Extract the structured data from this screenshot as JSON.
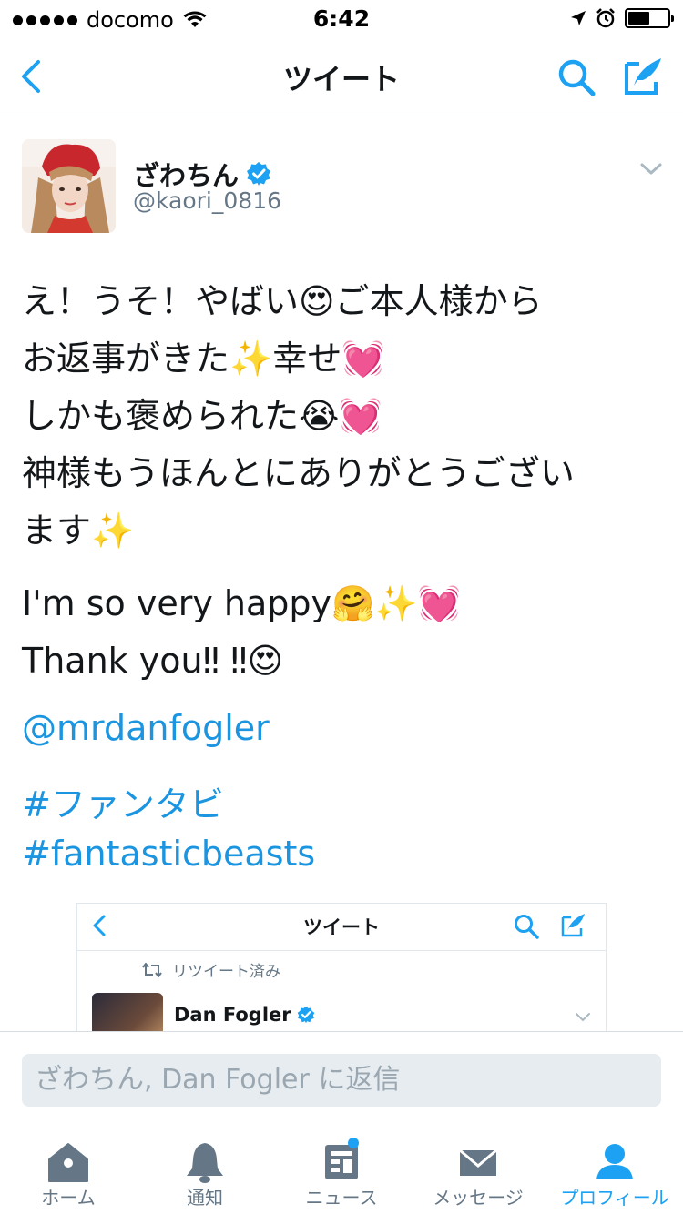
{
  "status_bar": {
    "carrier": "docomo",
    "time": "6:42",
    "battery_level": 0.55
  },
  "nav": {
    "title": "ツイート"
  },
  "tweet": {
    "author_name": "ざわちん",
    "author_handle": "@kaori_0816",
    "verified": true,
    "text_lines": [
      "え！うそ！やばい😍ご本人様から",
      "お返事がきた✨幸せ💓",
      "しかも褒められた😭💓",
      "神様もうほんとにありがとうござい",
      "ます✨"
    ],
    "english_lines": [
      "I'm so very happy🤗✨💓",
      "Thank you‼ ‼😍"
    ],
    "mention": "@mrdanfogler",
    "hashtag_1": "#ファンタビ",
    "hashtag_2": "#fantasticbeasts"
  },
  "embedded": {
    "title": "ツイート",
    "retweeted_label": "リツイート済み",
    "author_name": "Dan Fogler"
  },
  "reply": {
    "placeholder": "ざわちん, Dan Fogler に返信"
  },
  "tabs": [
    {
      "label": "ホーム",
      "icon": "home-icon",
      "active": false
    },
    {
      "label": "通知",
      "icon": "bell-icon",
      "active": false
    },
    {
      "label": "ニュース",
      "icon": "news-icon",
      "active": false,
      "badge": true
    },
    {
      "label": "メッセージ",
      "icon": "envelope-icon",
      "active": false
    },
    {
      "label": "プロフィール",
      "icon": "profile-icon",
      "active": true
    }
  ],
  "colors": {
    "accent": "#1da1f2",
    "link": "#1b95e0",
    "icon_gray": "#657786",
    "verified": "#1da1f2"
  }
}
